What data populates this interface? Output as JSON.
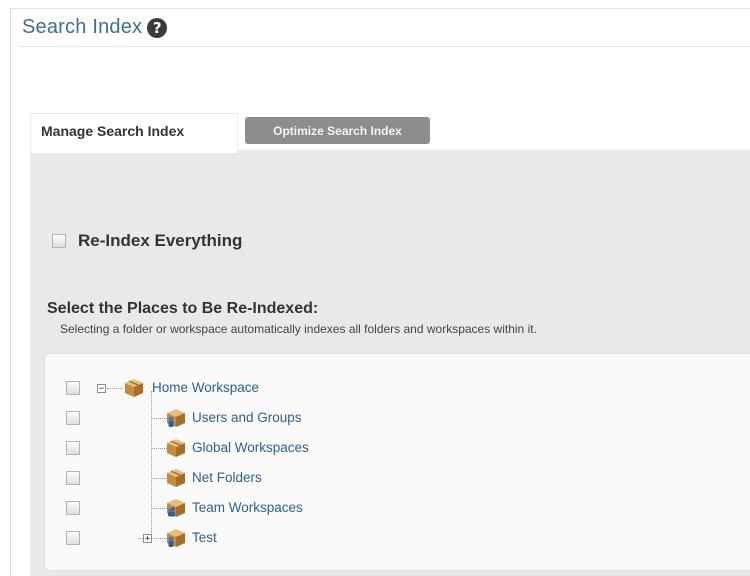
{
  "header": {
    "title": "Search Index",
    "help_icon": "help-icon"
  },
  "tabs": [
    {
      "label": "Manage Search Index",
      "active": true
    },
    {
      "label": "Optimize Search Index",
      "active": false
    }
  ],
  "reindex_everything": {
    "label": "Re-Index Everything",
    "checked": false
  },
  "select_places": {
    "heading": "Select the Places to Be Re-Indexed:",
    "description": "Selecting a folder or workspace automatically indexes all folders and workspaces within it."
  },
  "tree": {
    "root": {
      "label": "Home Workspace",
      "expander": "−",
      "icon": "workspace-cube-icon"
    },
    "children": [
      {
        "label": "Users and Groups",
        "icon": "user-workspace-icon"
      },
      {
        "label": "Global Workspaces",
        "icon": "workspace-cube-icon"
      },
      {
        "label": "Net Folders",
        "icon": "workspace-cube-icon"
      },
      {
        "label": "Team Workspaces",
        "icon": "team-workspace-icon"
      },
      {
        "label": "Test",
        "icon": "user-workspace-icon",
        "expander": "+"
      }
    ]
  },
  "colors": {
    "link": "#2e5f8f",
    "title": "#3a6f9a",
    "panel": "#e9e9e9",
    "inactive_tab": "#8d8d8d"
  }
}
